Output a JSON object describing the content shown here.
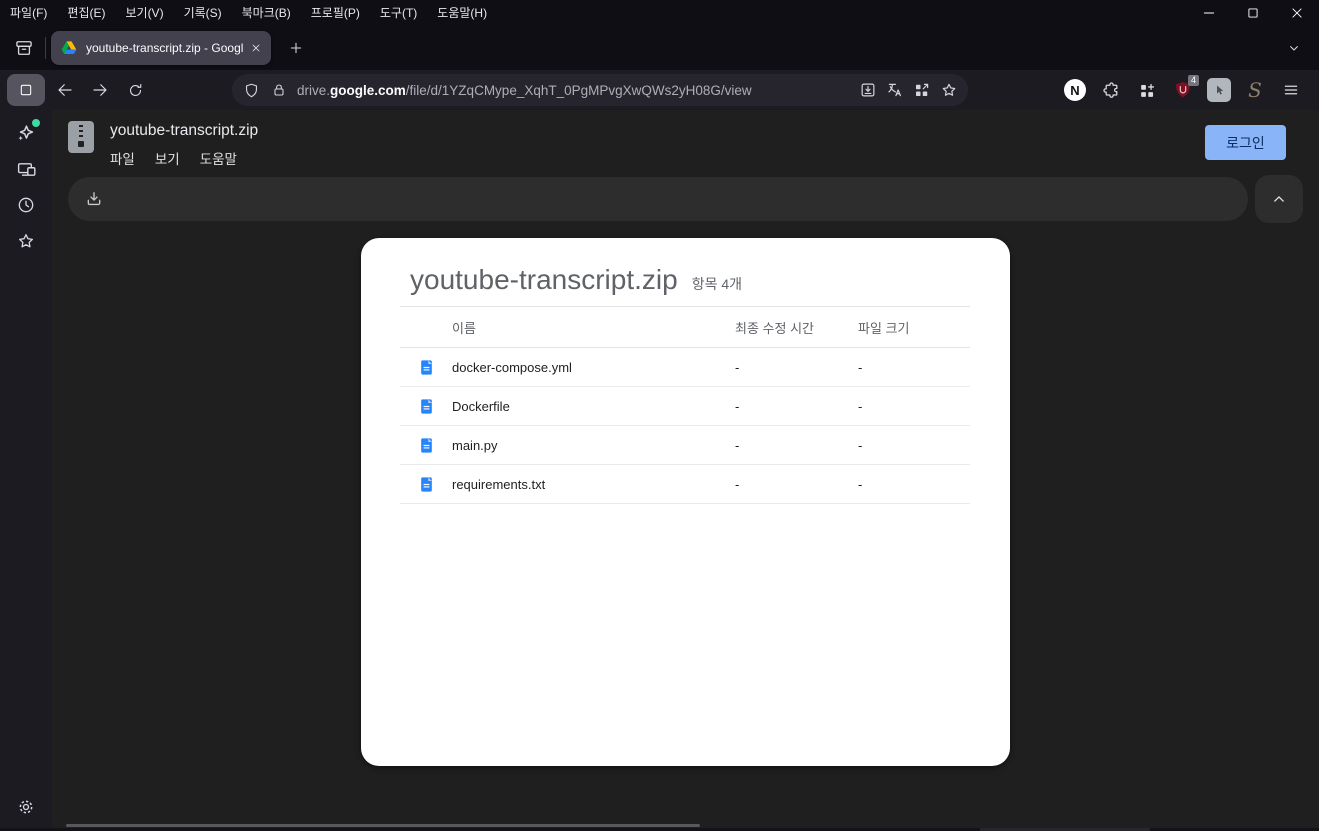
{
  "window": {
    "menu": [
      "파일(F)",
      "편집(E)",
      "보기(V)",
      "기록(S)",
      "북마크(B)",
      "프로필(P)",
      "도구(T)",
      "도움말(H)"
    ]
  },
  "tab_bar": {
    "active_tab_title": "youtube-transcript.zip - Googl"
  },
  "toolbar": {
    "url_host_prefix": "drive.",
    "url_host_bold": "google.com",
    "url_path": "/file/d/1YZqCMype_XqhT_0PgMPvgXwQWs2yH08G/view",
    "notion_letter": "N",
    "ublock_badge_count": "4",
    "script_ext_letter": "S"
  },
  "drive": {
    "header": {
      "file_title": "youtube-transcript.zip",
      "menu": [
        "파일",
        "보기",
        "도움말"
      ],
      "login_label": "로그인"
    },
    "card": {
      "title": "youtube-transcript.zip",
      "item_count": "항목 4개",
      "columns": [
        "이름",
        "최종 수정 시간",
        "파일 크기"
      ],
      "files": [
        {
          "name": "docker-compose.yml",
          "modified": "-",
          "size": "-"
        },
        {
          "name": "Dockerfile",
          "modified": "-",
          "size": "-"
        },
        {
          "name": "main.py",
          "modified": "-",
          "size": "-"
        },
        {
          "name": "requirements.txt",
          "modified": "-",
          "size": "-"
        }
      ]
    }
  },
  "colors": {
    "login_blue": "#8ab4f8",
    "file_icon_blue": "#2684fc",
    "ublock_red": "#7e1022",
    "drive_yellow": "#ffba00",
    "drive_green": "#00ac47",
    "drive_blue": "#2684fc",
    "online_green": "#3fd9a4"
  }
}
